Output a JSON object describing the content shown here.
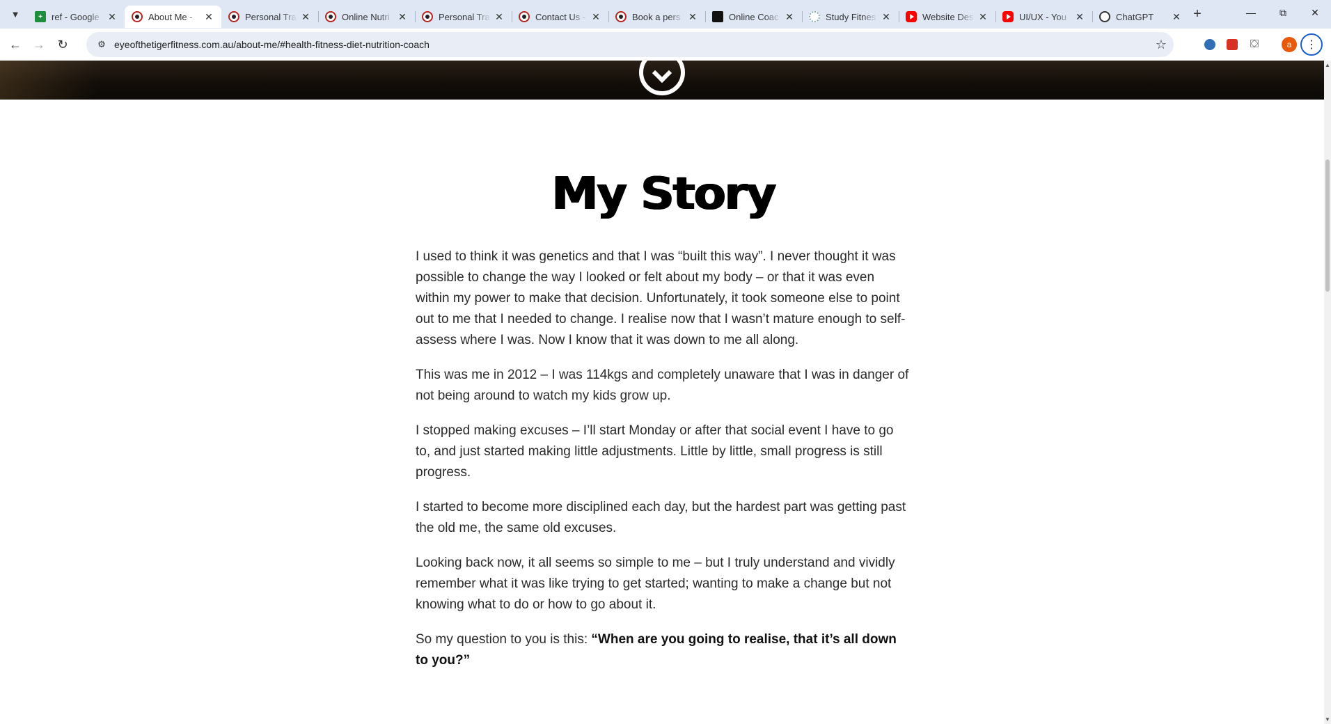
{
  "browser": {
    "tabs": [
      {
        "title": "ref - Google",
        "favicon": "sheets-icon",
        "active": false
      },
      {
        "title": "About Me -",
        "favicon": "tiger-icon",
        "active": true
      },
      {
        "title": "Personal Tra",
        "favicon": "tiger-icon",
        "active": false
      },
      {
        "title": "Online Nutri",
        "favicon": "tiger-icon",
        "active": false
      },
      {
        "title": "Personal Tra",
        "favicon": "tiger-icon",
        "active": false
      },
      {
        "title": "Contact Us -",
        "favicon": "tiger-icon",
        "active": false
      },
      {
        "title": "Book a pers",
        "favicon": "tiger-icon",
        "active": false
      },
      {
        "title": "Online Coac",
        "favicon": "coach-icon",
        "active": false
      },
      {
        "title": "Study Fitnes",
        "favicon": "study-icon",
        "active": false
      },
      {
        "title": "Website Des",
        "favicon": "youtube-icon",
        "active": false
      },
      {
        "title": "UI/UX - You",
        "favicon": "youtube-icon",
        "active": false
      },
      {
        "title": "ChatGPT",
        "favicon": "chatgpt-icon",
        "active": false
      }
    ],
    "url": "eyeofthetigerfitness.com.au/about-me/#health-fitness-diet-nutrition-coach",
    "profile_initial": "a",
    "colors": {
      "tabstrip": "#dfe7f5",
      "omnibox": "#e9eef6",
      "profile": "#e8590c",
      "hero": "#120d08"
    }
  },
  "story": {
    "title": "My Story",
    "paragraphs": [
      "I used to think it was genetics and that I was “built this way”. I never thought it was possible to change the way I looked or felt about my body – or that it was even within my power to make that decision.  Unfortunately, it took someone else to point out to me that I needed to change. I realise now that I wasn’t mature enough to self-assess where I was.  Now I know that it was down to me all along.",
      "This was me in 2012 – I was 114kgs and completely unaware that I was in danger of not being around to watch my kids grow up.",
      "I stopped making excuses – I’ll start Monday or after that social event I have to go to, and just started making little adjustments. Little by little, small progress is still progress.",
      "I started to become more disciplined each day, but the hardest part was getting past the old me, the same old excuses.",
      "Looking back now, it all seems so simple to me – but I truly understand and vividly remember what it was like trying to get started; wanting to make a change but not knowing what to do or how to go about it."
    ],
    "closing_lead": "So my question to you is this: ",
    "closing_quote": "“When are you going to realise, that it’s all down to you?”"
  }
}
